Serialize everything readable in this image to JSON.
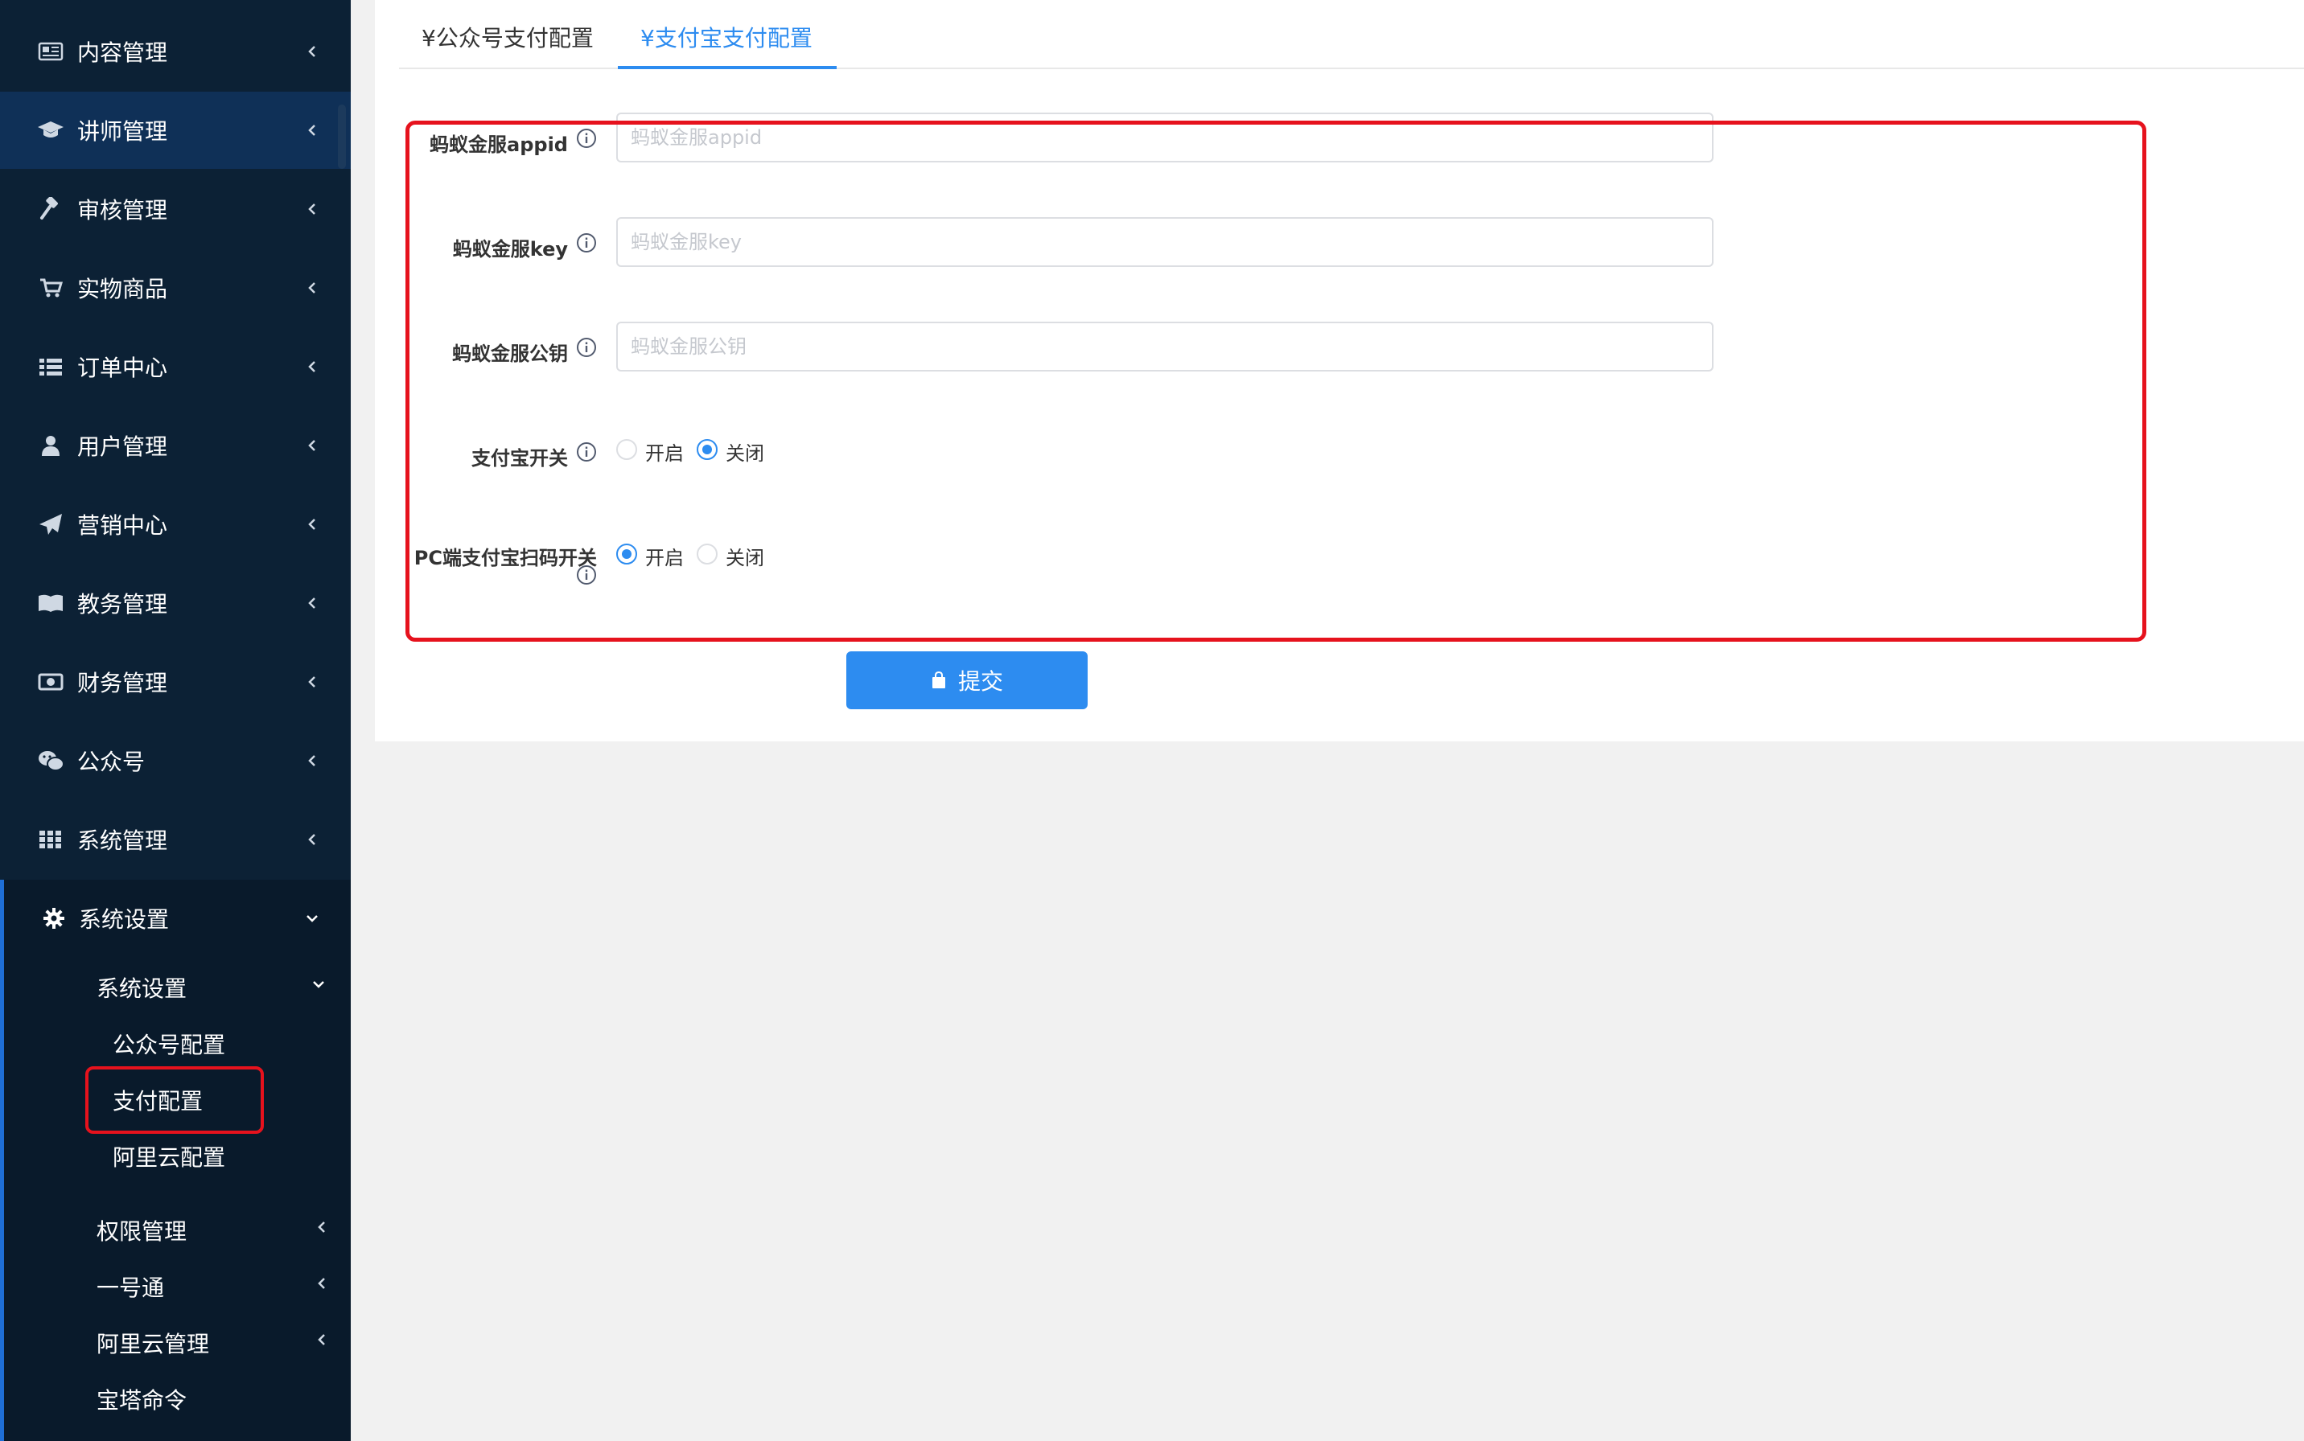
{
  "sidebar": {
    "items": [
      {
        "label": "内容管理",
        "icon": "newspaper-icon"
      },
      {
        "label": "讲师管理",
        "icon": "graduation-cap-icon"
      },
      {
        "label": "审核管理",
        "icon": "gavel-icon"
      },
      {
        "label": "实物商品",
        "icon": "cart-icon"
      },
      {
        "label": "订单中心",
        "icon": "list-icon"
      },
      {
        "label": "用户管理",
        "icon": "user-icon"
      },
      {
        "label": "营销中心",
        "icon": "paper-plane-icon"
      },
      {
        "label": "教务管理",
        "icon": "book-icon"
      },
      {
        "label": "财务管理",
        "icon": "money-icon"
      },
      {
        "label": "公众号",
        "icon": "wechat-icon"
      },
      {
        "label": "系统管理",
        "icon": "grid-icon"
      }
    ],
    "expanded": {
      "label": "系统设置",
      "icon": "gear-icon",
      "group": {
        "label": "系统设置",
        "children": [
          "公众号配置",
          "支付配置",
          "阿里云配置"
        ]
      },
      "others": [
        "权限管理",
        "一号通",
        "阿里云管理",
        "宝塔命令"
      ]
    }
  },
  "tabs": [
    {
      "label": "¥公众号支付配置",
      "active": false
    },
    {
      "label": "¥支付宝支付配置",
      "active": true
    }
  ],
  "form": {
    "fields": [
      {
        "label": "蚂蚁金服appid",
        "placeholder": "蚂蚁金服appid",
        "value": ""
      },
      {
        "label": "蚂蚁金服key",
        "placeholder": "蚂蚁金服key",
        "value": ""
      },
      {
        "label": "蚂蚁金服公钥",
        "placeholder": "蚂蚁金服公钥",
        "value": ""
      }
    ],
    "switches": [
      {
        "label": "支付宝开关",
        "options": [
          "开启",
          "关闭"
        ],
        "selected": "关闭"
      },
      {
        "label": "PC端支付宝扫码开关",
        "options": [
          "开启",
          "关闭"
        ],
        "selected": "开启"
      }
    ],
    "submit_label": "提交"
  },
  "colors": {
    "sidebar_bg": "#0c2135",
    "accent": "#2d8cf0",
    "highlight": "#e6121d"
  }
}
